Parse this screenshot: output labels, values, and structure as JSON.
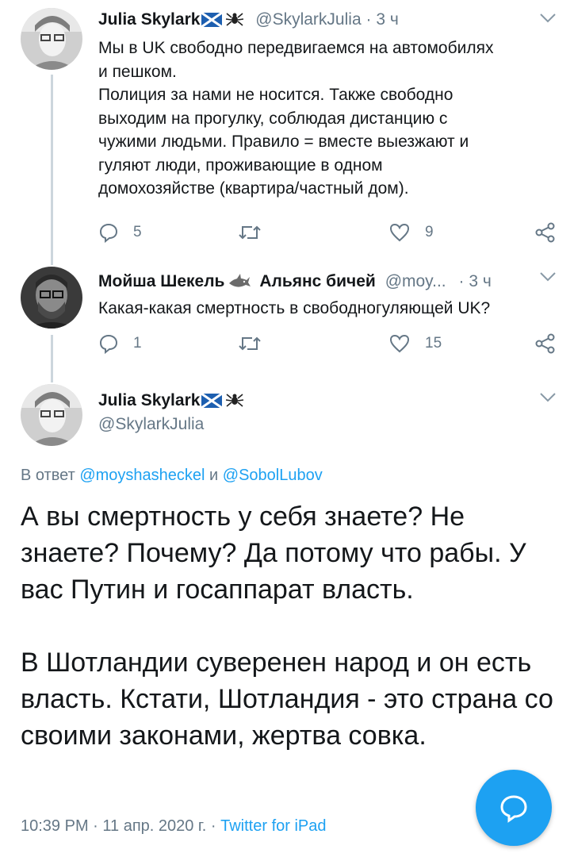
{
  "tweet1": {
    "name": "Julia Skylark",
    "handle": "@SkylarkJulia",
    "sep": "·",
    "time": "3 ч",
    "text": "Мы в UK свободно передвигаемся на автомобилях\nи пешком.\nПолиция за нами не носится. Также свободно\nвыходим на прогулку, соблюдая дистанцию с\nчужими людьми. Правило = вместе выезжают и\nгуляют люди, проживающие в одном\nдомохозяйстве (квартира/частный дом).",
    "replies": "5",
    "retweets": "",
    "likes": "9"
  },
  "tweet2": {
    "name": "Мойша Шекель",
    "name_suffix": "Альянс бичей",
    "handle": "@moy...",
    "sep": "·",
    "time": "3 ч",
    "text": "Какая-какая смертность в свободногуляющей UK?",
    "replies": "1",
    "retweets": "",
    "likes": "15"
  },
  "main": {
    "name": "Julia Skylark",
    "handle": "@SkylarkJulia",
    "reply_prefix": "В ответ",
    "mention1": "@moyshasheckel",
    "reply_and": "и",
    "mention2": "@SobolLubov",
    "para1": "А вы смертность у себя знаете? Не знаете? Почему? Да потому что рабы. У вас Путин и госаппарат власть.",
    "para2": "В Шотландии суверенен народ и он есть власть. Кстати, Шотландия - это страна со своими законами, жертва совка.",
    "timestamp": "10:39 PM · 11 апр. 2020 г. ·",
    "source": "Twitter for iPad"
  },
  "icons": {
    "reply": "reply-icon",
    "retweet": "retweet-icon",
    "like": "heart-icon",
    "share": "share-icon",
    "chevron": "chevron-down-icon",
    "compose": "compose-reply-icon"
  },
  "colors": {
    "text": "#14171a",
    "secondary": "#657786",
    "accent": "#1da1f2",
    "thread_line": "#ccd6dd"
  }
}
